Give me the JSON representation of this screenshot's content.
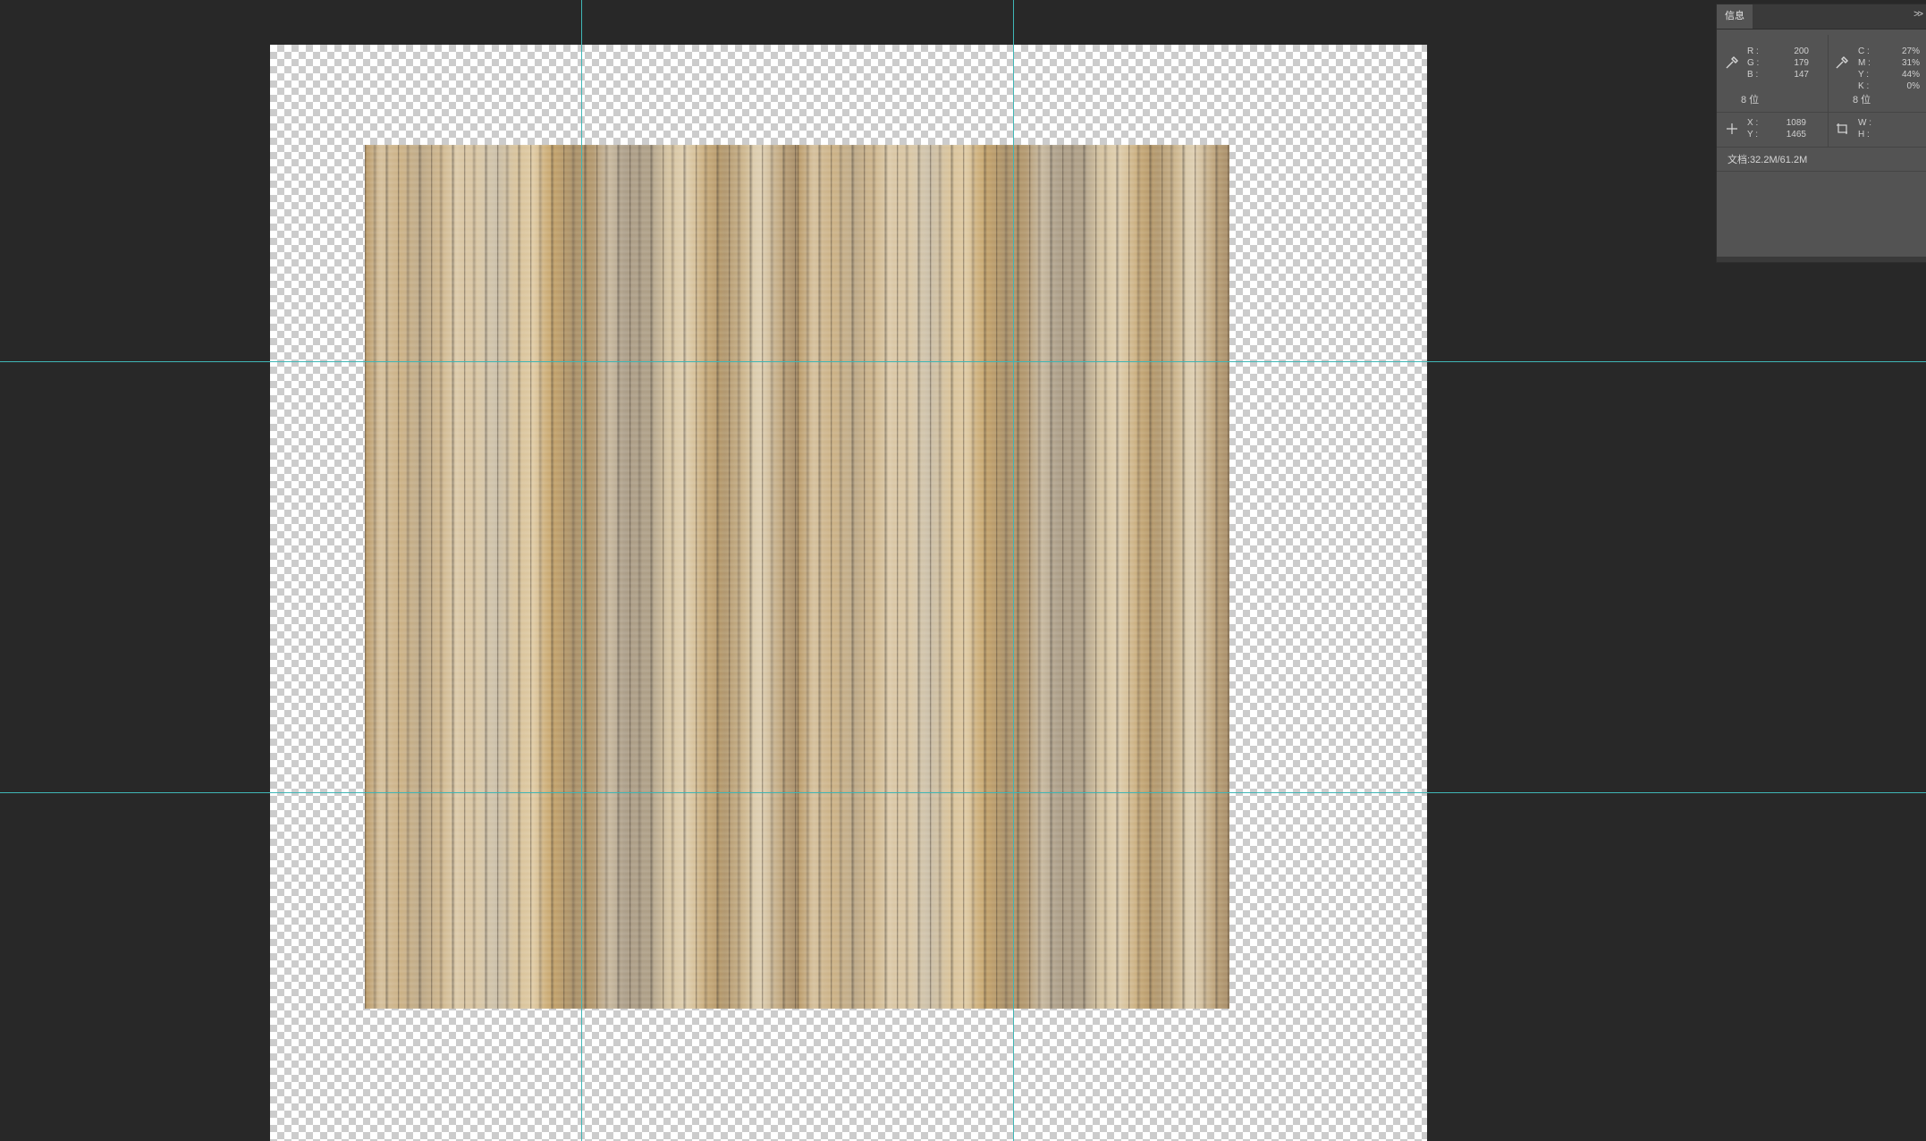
{
  "panel": {
    "tab_label": "信息",
    "menu_icon": "double-chevron-right-icon",
    "rgb": {
      "r_label": "R :",
      "r_value": "200",
      "g_label": "G :",
      "g_value": "179",
      "b_label": "B :",
      "b_value": "147",
      "bits": "8 位"
    },
    "cmyk": {
      "c_label": "C :",
      "c_value": "27%",
      "m_label": "M :",
      "m_value": "31%",
      "y_label": "Y :",
      "y_value": "44%",
      "k_label": "K :",
      "k_value": "0%",
      "bits": "8 位"
    },
    "position": {
      "x_label": "X :",
      "x_value": "1089",
      "y_label": "Y :",
      "y_value": "1465"
    },
    "size": {
      "w_label": "W :",
      "w_value": "",
      "h_label": "H :",
      "h_value": ""
    },
    "doc_info": "文档:32.2M/61.2M"
  },
  "colors": {
    "workspace": "#282828",
    "guide": "#3fb6b6",
    "panel_bg": "#535353"
  }
}
